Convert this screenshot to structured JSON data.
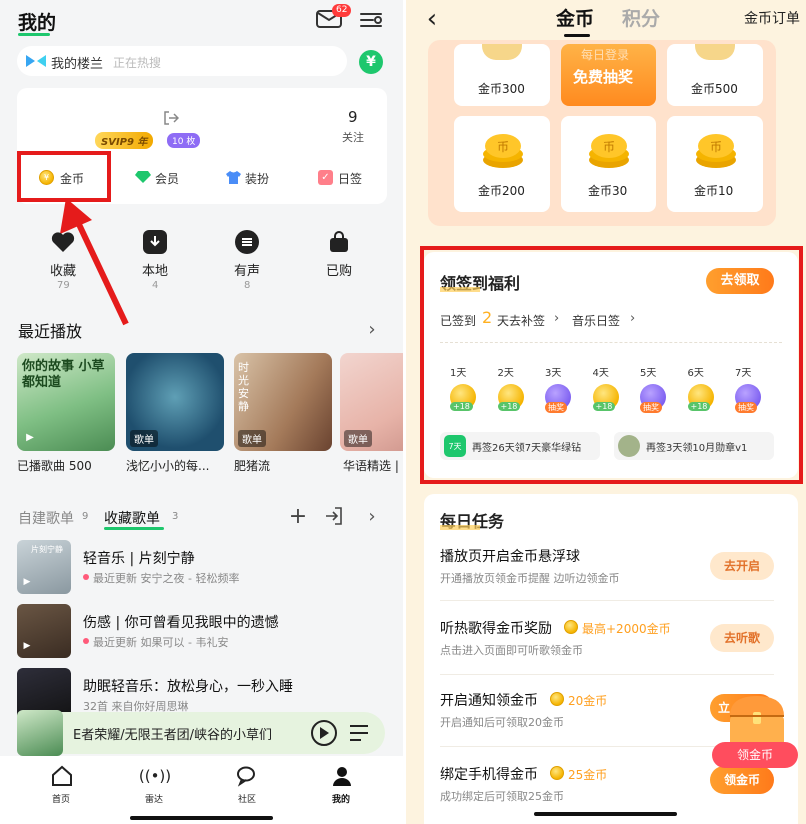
{
  "left": {
    "header": {
      "title": "我的",
      "mail_badge": "62"
    },
    "search": {
      "placeholder": "我的楼兰",
      "hint": "正在热搜",
      "right_icon": "yen"
    },
    "profile": {
      "vip_label": "SVIP9 年",
      "coin_badge": "10 枚",
      "follow_count": "9",
      "follow_label": "关注"
    },
    "quick": [
      {
        "label": "金币",
        "icon": "coin-icon"
      },
      {
        "label": "会员",
        "icon": "diamond-icon"
      },
      {
        "label": "装扮",
        "icon": "shirt-icon"
      },
      {
        "label": "日签",
        "icon": "checkbox-icon"
      }
    ],
    "stats": [
      {
        "label": "收藏",
        "count": "79"
      },
      {
        "label": "本地",
        "count": "4"
      },
      {
        "label": "有声",
        "count": "8"
      },
      {
        "label": "已购",
        "count": ""
      }
    ],
    "recent": {
      "title": "最近播放",
      "items": [
        {
          "caption": "已播歌曲 500",
          "tag": "",
          "art": "你的故事 小草都知道"
        },
        {
          "caption": "浅忆小小的每...",
          "tag": "歌单",
          "art": ""
        },
        {
          "caption": "肥猪流",
          "tag": "歌单",
          "art": "时光安静"
        },
        {
          "caption": "华语精选 |",
          "tag": "歌单",
          "art": ""
        }
      ]
    },
    "playlist_tabs": {
      "created_label": "自建歌单",
      "created_count": "9",
      "collected_label": "收藏歌单",
      "collected_count": "3"
    },
    "playlists": [
      {
        "title": "轻音乐 | 片刻宁静",
        "sub": "最近更新 安宁之夜 - 轻松频率",
        "thumb": "片刻宁静"
      },
      {
        "title": "伤感 | 你可曾看见我眼中的遗憾",
        "sub": "最近更新 如果可以 - 韦礼安",
        "thumb": ""
      },
      {
        "title": "助眠轻音乐：放松身心，一秒入睡",
        "sub": "32首 来自你好周思琳",
        "thumb": ""
      }
    ],
    "player": {
      "now_playing": "E者荣耀/无限王者团/峡谷的小草们"
    },
    "tabbar": [
      {
        "label": "首页",
        "icon": "home-icon"
      },
      {
        "label": "雷达",
        "icon": "radar-icon"
      },
      {
        "label": "社区",
        "icon": "chat-icon"
      },
      {
        "label": "我的",
        "icon": "user-icon"
      }
    ]
  },
  "right": {
    "nav": {
      "tab_active": "金币",
      "tab_inactive": "积分",
      "orders": "金币订单"
    },
    "grid_top": [
      {
        "label": "金币300"
      },
      {
        "label": "免费抽奖",
        "banner": "每日登录"
      },
      {
        "label": "金币500"
      }
    ],
    "grid_bottom": [
      {
        "label": "金币200"
      },
      {
        "label": "金币30"
      },
      {
        "label": "金币10"
      }
    ],
    "checkin": {
      "title": "领签到福利",
      "button": "去领取",
      "signed_prefix": "已签到",
      "signed_days": "2",
      "signed_suffix": "天去补签",
      "music_sign": "音乐日签",
      "days": [
        {
          "label": "1天",
          "reward": "+18",
          "type": "coin"
        },
        {
          "label": "2天",
          "reward": "+18",
          "type": "coin"
        },
        {
          "label": "3天",
          "reward": "抽奖",
          "type": "gift"
        },
        {
          "label": "4天",
          "reward": "+18",
          "type": "coin"
        },
        {
          "label": "5天",
          "reward": "抽奖",
          "type": "gift"
        },
        {
          "label": "6天",
          "reward": "+18",
          "type": "coin"
        },
        {
          "label": "7天",
          "reward": "抽奖",
          "type": "gift"
        }
      ],
      "promo_a": {
        "text": "再签26天领7天豪华绿钻",
        "icon_text": "7天"
      },
      "promo_b": {
        "text": "再签3天领10月勋章v1"
      }
    },
    "daily": {
      "title": "每日任务",
      "tasks": [
        {
          "title": "播放页开启金币悬浮球",
          "reward": "",
          "sub": "开通播放页领金币提醒 边听边领金币",
          "button": "去开启"
        },
        {
          "title": "听热歌得金币奖励",
          "reward": "最高+2000金币",
          "sub": "点击进入页面即可听歌领金币",
          "button": "去听歌"
        },
        {
          "title": "开启通知领金币",
          "reward": "20金币",
          "sub": "开启通知后可领取20金币",
          "button": "立"
        },
        {
          "title": "绑定手机得金币",
          "reward": "25金币",
          "sub": "成功绑定后可领取25金币",
          "button": "领金币"
        }
      ]
    },
    "floating_chest": {
      "label": "领金币"
    }
  },
  "colors": {
    "brand_green": "#1ec76d",
    "orange": "#ff8a1f",
    "annotation_red": "#e51b1b"
  }
}
